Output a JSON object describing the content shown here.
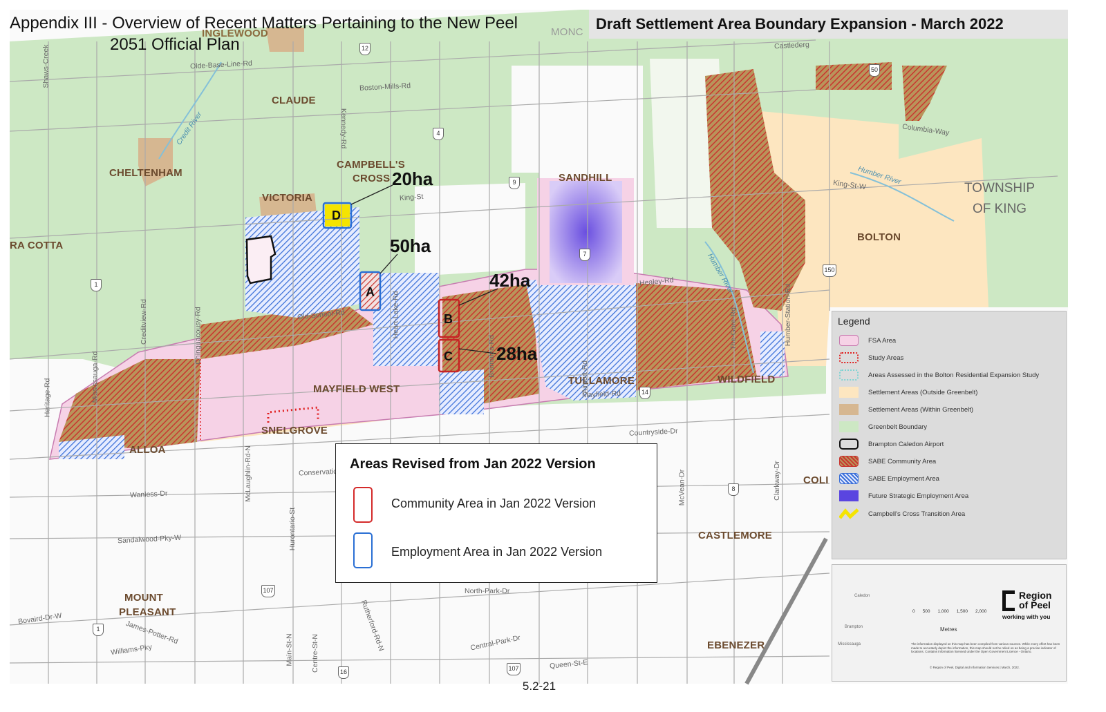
{
  "document": {
    "title_line1": "Appendix III - Overview of Recent Matters Pertaining to the New Peel",
    "title_line2": "2051 Official Plan",
    "page_number": "5.2-21"
  },
  "map": {
    "header": "Draft Settlement Area Boundary Expansion - March 2022",
    "places": {
      "inglewood": "INGLEWOOD",
      "mono": "MONC",
      "claude": "CLAUDE",
      "cheltenham": "CHELTENHAM",
      "campbells_cross_1": "CAMPBELL'S",
      "campbells_cross_2": "CROSS",
      "victoria": "VICTORIA",
      "terra_cotta": "RA COTTA",
      "sandhill": "SANDHILL",
      "bolton": "BOLTON",
      "township_king_1": "TOWNSHIP",
      "township_king_2": "OF KING",
      "mayfield_west": "MAYFIELD WEST",
      "snelgrove": "SNELGROVE",
      "alloa": "ALLOA",
      "tullamore": "TULLAMORE",
      "wildfield": "WILDFIELD",
      "castlemore": "CASTLEMORE",
      "col": "COLI",
      "mount_pleasant_1": "MOUNT",
      "mount_pleasant_2": "PLEASANT",
      "ebenezer": "EBENEZER"
    },
    "roads": {
      "olde_base_line": "Olde-Base-Line-Rd",
      "boston_mills": "Boston-Mills-Rd",
      "credit_river": "Credit River",
      "kennedy": "Kennedy-Rd",
      "king_st": "King-St",
      "king_st_w": "King-St-W",
      "humber_river": "Humber River",
      "old_school": "Old-School-Rd",
      "mayfield": "Mayfield-Rd",
      "countryside": "Countryside-Dr",
      "wanless": "Wanless-Dr",
      "sandalwood": "Sandalwood-Pky-W",
      "bovaird": "Bovaird-Dr-W",
      "north_park": "North-Park-Dr",
      "queen_st": "Queen-St-E",
      "heritage": "Heritage-Rd",
      "mississauga": "Mississauga-Rd",
      "creditview": "Creditview-Rd",
      "chinguacousy": "Chinguacousy-Rd",
      "mclaughlin": "McLaughlin-Rd-N",
      "hurontario": "Hurontario-St",
      "heart_lake": "Heart-Lake-Rd",
      "bramalea": "Bramalea-Rd",
      "airport": "Airport-Rd",
      "healey": "Healey-Rd",
      "the_gore": "The-Gore-Rd",
      "mcvean": "McVean-Dr",
      "clarkway": "Clarkway-Dr",
      "humber_station": "Humber-Station-Rd",
      "gastle": "Castlederg",
      "columbia": "Columbia-Way",
      "conservation": "Conservation",
      "williams": "Williams-Pky",
      "central_park": "Central-Park-Dr",
      "main_st": "Main-St-N",
      "centre_st": "Centre-St-N",
      "rutherford": "Rutherford-Rd-N",
      "james_potter": "James-Potter-Rd",
      "shaws_creek": "Shaws-Creek"
    },
    "highways": [
      "12",
      "4",
      "9",
      "7",
      "1",
      "50",
      "150",
      "14",
      "8",
      "107",
      "1",
      "16",
      "107"
    ],
    "areas": [
      {
        "id": "A",
        "hectares": "50ha",
        "jan_version": "employment"
      },
      {
        "id": "B",
        "hectares": "42ha",
        "jan_version": "community"
      },
      {
        "id": "C",
        "hectares": "28ha",
        "jan_version": "community"
      },
      {
        "id": "D",
        "hectares": "20ha",
        "jan_version": "employment"
      }
    ]
  },
  "revised_box": {
    "title": "Areas Revised from Jan 2022 Version",
    "community_label": "Community Area in Jan 2022 Version",
    "employment_label": "Employment Area in Jan 2022 Version",
    "community_color": "#d42a2a",
    "employment_color": "#2a6fd4"
  },
  "legend": {
    "title": "Legend",
    "items": [
      {
        "label": "FSA Area",
        "icon": "fsa-swatch"
      },
      {
        "label": "Study Areas",
        "icon": "study-swatch"
      },
      {
        "label": "Areas Assessed in the Bolton Residential Expansion Study",
        "icon": "bolton-swatch"
      },
      {
        "label": "Settlement Areas (Outside Greenbelt)",
        "icon": "settlement-outside-swatch"
      },
      {
        "label": "Settlement Areas (Within Greenbelt)",
        "icon": "settlement-within-swatch"
      },
      {
        "label": "Greenbelt Boundary",
        "icon": "greenbelt-swatch"
      },
      {
        "label": "Brampton Caledon Airport",
        "icon": "airport-swatch"
      },
      {
        "label": "SABE Community Area",
        "icon": "community-swatch"
      },
      {
        "label": "SABE Employment Area",
        "icon": "employment-swatch"
      },
      {
        "label": "Future Strategic Employment Area",
        "icon": "strategic-swatch"
      },
      {
        "label": "Campbell's Cross Transition Area",
        "icon": "transition-swatch"
      }
    ]
  },
  "inset": {
    "caledon": "Caledon",
    "brampton": "Brampton",
    "mississauga": "Mississauga",
    "scale_ticks": [
      "0",
      "500",
      "1,000",
      "1,500",
      "2,000"
    ],
    "scale_unit": "Metres",
    "brand_1": "Region",
    "brand_2": "of Peel",
    "brand_3": "working with you",
    "disclaimer": "The information displayed on this map has been compiled from various sources. While every effort has been made to accurately depict the information, this map should not be relied on as being a precise indicator of locations. Contains information licensed under the Open Government Licence - Ontario.",
    "credit": "© Region of Peel, Digital and Information Services | March, 2022."
  },
  "colors": {
    "greenbelt": "#cde8c4",
    "settlement_outside": "#fde6c0",
    "settlement_within": "#d6b791",
    "fsa": "#f6d2e6",
    "community_hatch": "#c83a3a",
    "employment_hatch": "#3a6fd8",
    "strategic": "#8b72e8",
    "transition": "#f5e400"
  }
}
